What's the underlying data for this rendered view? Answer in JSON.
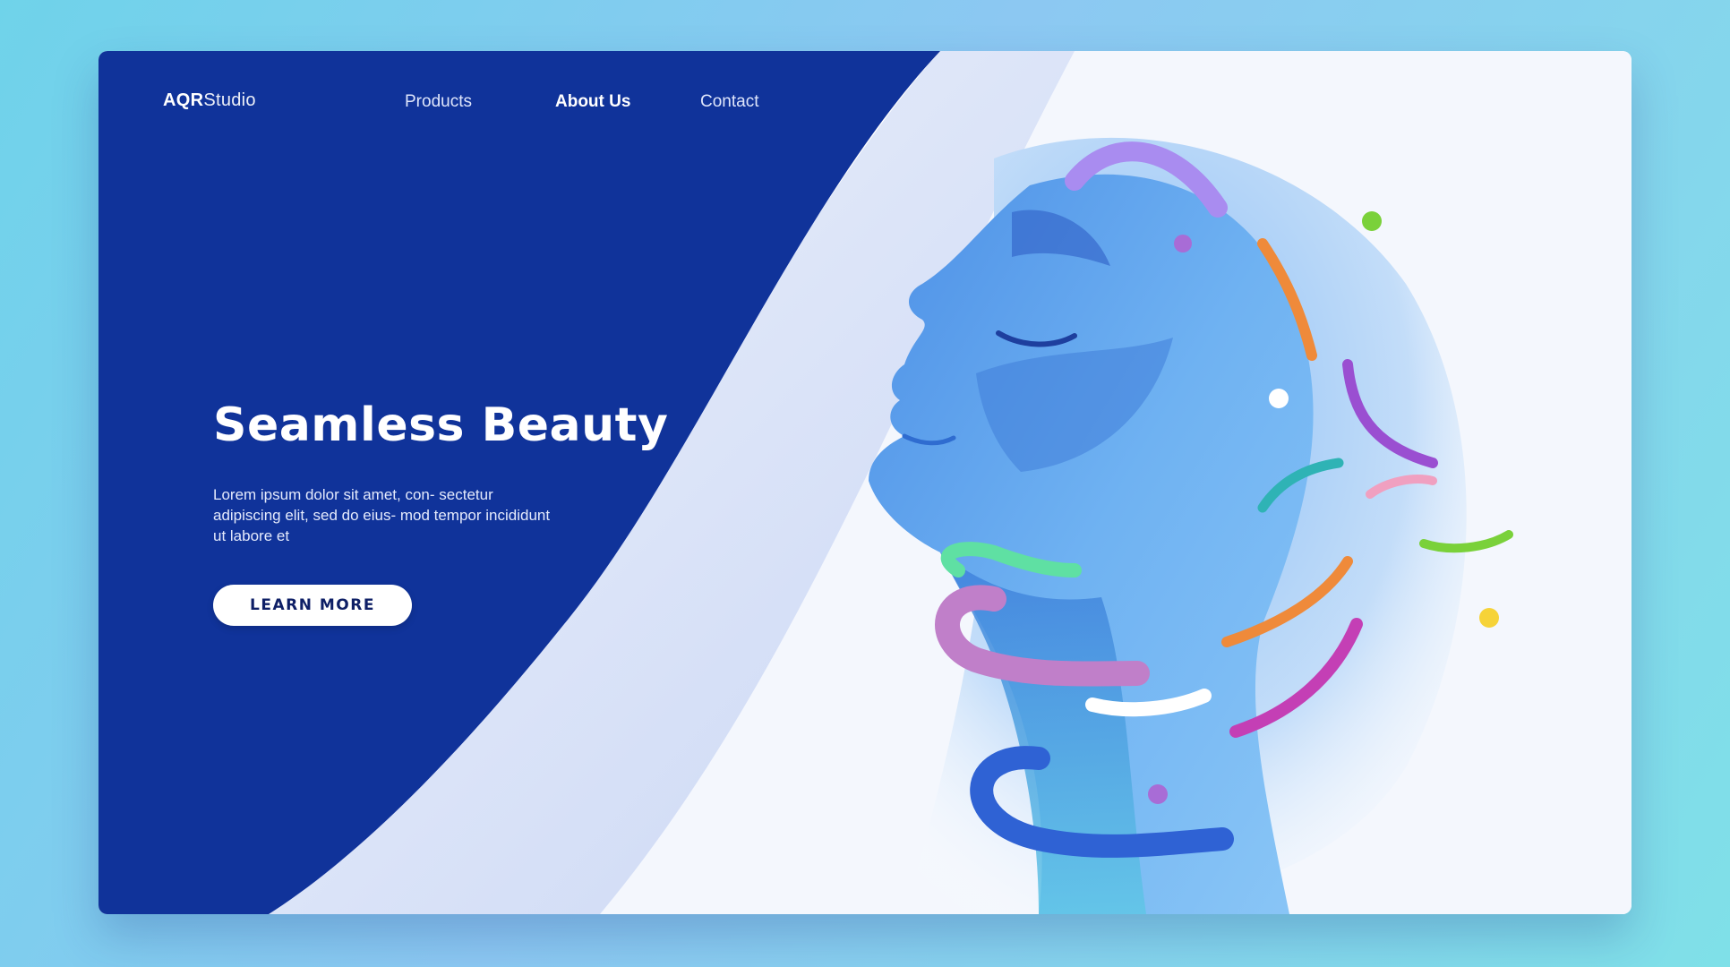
{
  "brand": {
    "logo_bold": "AQR",
    "logo_light": "Studio"
  },
  "nav": {
    "items": [
      {
        "label": "Products",
        "active": false
      },
      {
        "label": "About Us",
        "active": true
      },
      {
        "label": "Contact",
        "active": false
      }
    ]
  },
  "hero": {
    "title": "Seamless Beauty",
    "body": "Lorem ipsum dolor sit amet, con- sectetur adipiscing elit, sed do eius- mod tempor incididunt ut labore et",
    "cta_label": "LEARN MORE"
  },
  "colors": {
    "panel_blue": "#10339a",
    "face_blue": "#5aa3ee",
    "page_background": "#7dd3ec"
  }
}
